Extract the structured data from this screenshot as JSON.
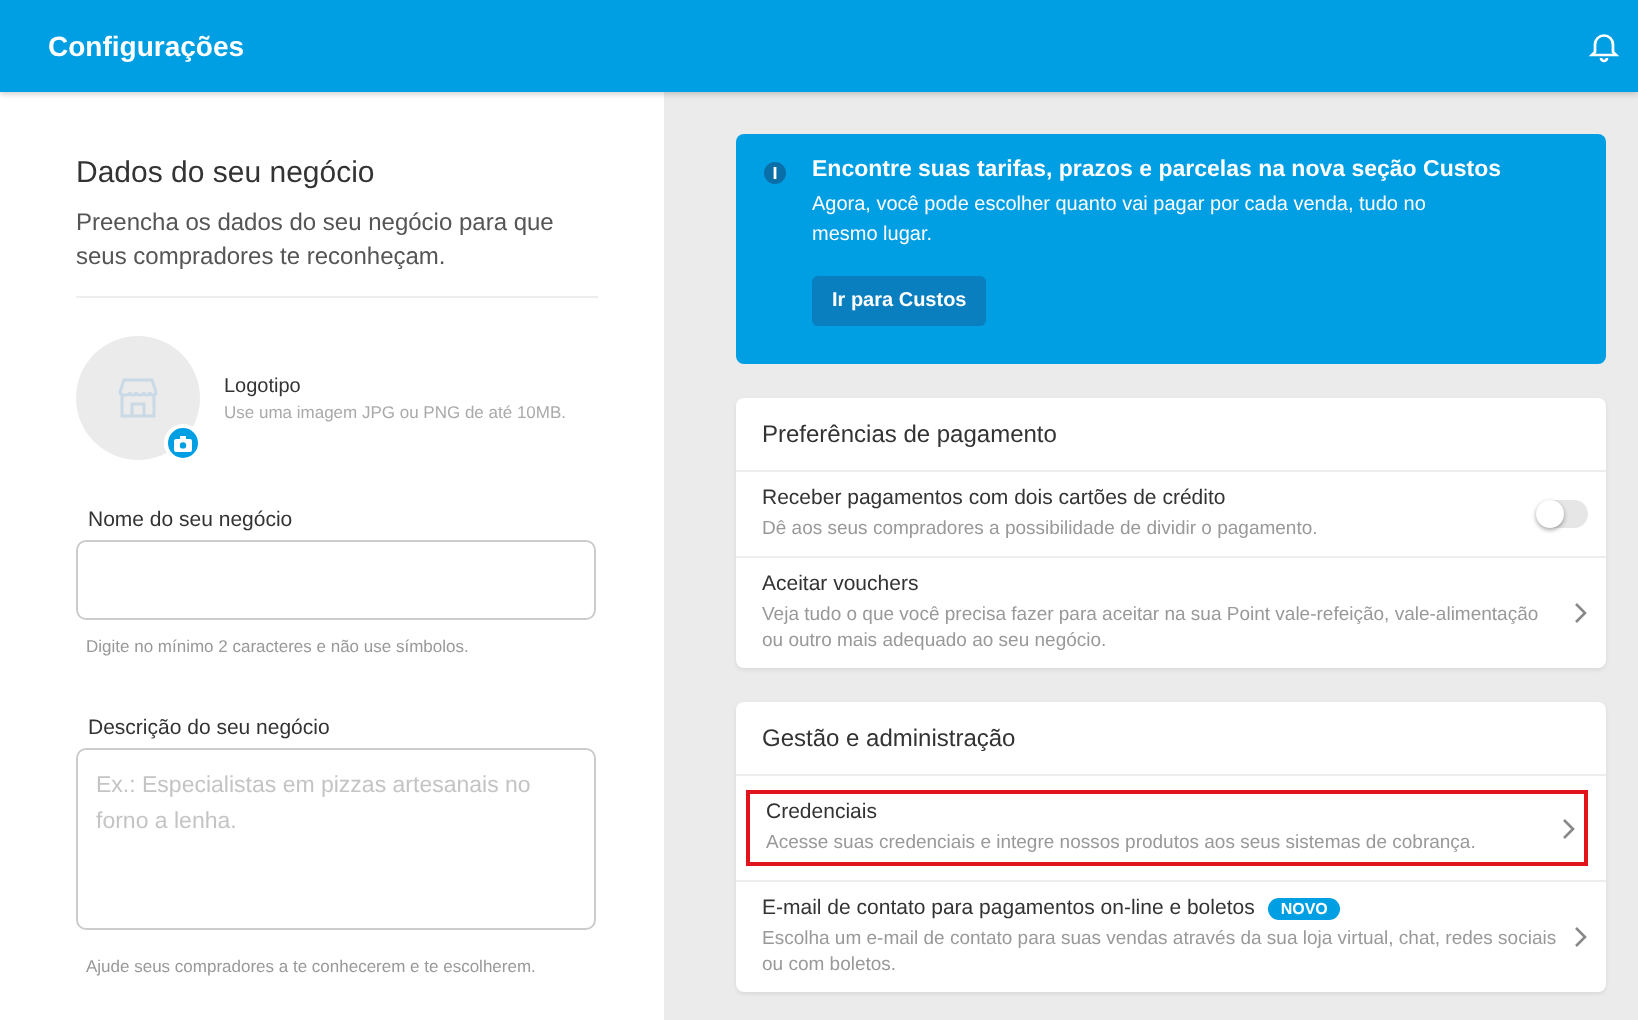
{
  "header": {
    "title": "Configurações"
  },
  "business": {
    "title": "Dados do seu negócio",
    "subtitle": "Preencha os dados do seu negócio para que seus compradores te reconheçam.",
    "logo": {
      "label": "Logotipo",
      "hint": "Use uma imagem JPG ou PNG de até 10MB."
    },
    "fields": [
      {
        "kind": "input",
        "label": "Nome do seu negócio",
        "hint": "Digite no mínimo 2 caracteres e não use símbolos."
      },
      {
        "kind": "textarea",
        "label": "Descrição do seu negócio",
        "placeholder": "Ex.: Especialistas em pizzas artesanais no forno a lenha.",
        "hint": "Ajude seus compradores a te conhecerem e te escolherem."
      }
    ]
  },
  "banner": {
    "title": "Encontre suas tarifas, prazos e parcelas na nova seção Custos",
    "text": "Agora, você pode escolher quanto vai pagar por cada venda, tudo no mesmo lugar.",
    "button": "Ir para Custos"
  },
  "sections": [
    {
      "title": "Preferências de pagamento",
      "rows": [
        {
          "kind": "toggle",
          "title": "Receber pagamentos com dois cartões de crédito",
          "description": "Dê aos seus compradores a possibilidade de dividir o pagamento.",
          "on": false,
          "highlighted": false
        },
        {
          "kind": "link",
          "title": "Aceitar vouchers",
          "description": "Veja tudo o que você precisa fazer para aceitar na sua Point vale-refeição, vale-alimentação ou outro mais adequado ao seu negócio.",
          "highlighted": false
        }
      ]
    },
    {
      "title": "Gestão e administração",
      "rows": [
        {
          "kind": "link",
          "title": "Credenciais",
          "description": "Acesse suas credenciais e integre nossos produtos aos seus sistemas de cobrança.",
          "highlighted": true
        },
        {
          "kind": "link",
          "title": "E-mail de contato para pagamentos on-line e boletos",
          "badge": "NOVO",
          "description": "Escolha um e-mail de contato para suas vendas através da sua loja virtual, chat, redes sociais ou com boletos.",
          "highlighted": false
        }
      ]
    }
  ]
}
